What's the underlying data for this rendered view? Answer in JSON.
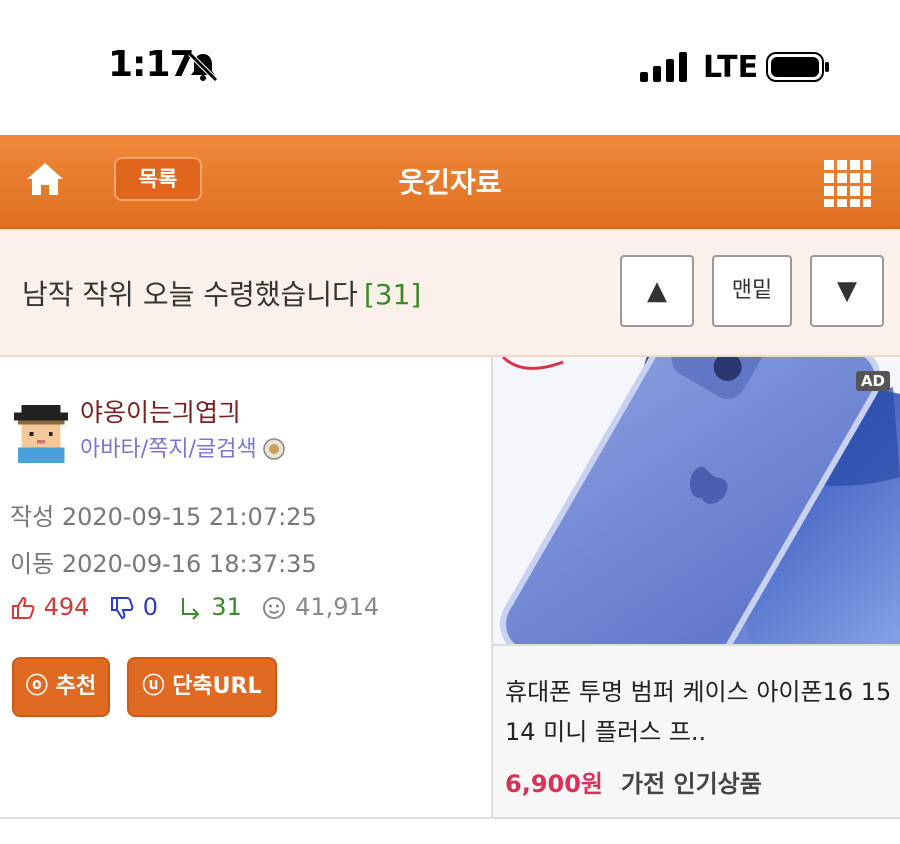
{
  "status_bar": {
    "time": "1:17",
    "network": "LTE",
    "icons": [
      "bell-slash-icon",
      "signal-icon",
      "battery-icon"
    ]
  },
  "header": {
    "list_label": "목록",
    "title": "웃긴자료",
    "icons": [
      "home-icon",
      "grid-menu-icon"
    ],
    "accent_color": "#e8772c"
  },
  "post": {
    "title": "남작 작위 오늘 수령했습니다",
    "comment_count": "[31]",
    "nav": {
      "up": "▲",
      "bottom": "맨밑",
      "down": "▼"
    }
  },
  "author": {
    "name": "야옹이는긔엽긔",
    "links": "아바타/쪽지/글검색"
  },
  "meta": {
    "written_label": "작성",
    "written": "2020-09-15 21:07:25",
    "moved_label": "이동",
    "moved": "2020-09-16 18:37:35"
  },
  "stats": {
    "upvotes": "494",
    "downvotes": "0",
    "replies": "31",
    "views": "41,914"
  },
  "actions": {
    "recommend_icon": "ⓞ",
    "recommend": "추천",
    "shorturl_icon": "ⓤ",
    "shorturl": "단축URL"
  },
  "ad": {
    "tag": "AD",
    "product": "휴대폰 투명 범퍼 케이스 아이폰16 15 14 미니 플러스 프..",
    "price": "6,900원",
    "category": "가전 인기상품"
  }
}
